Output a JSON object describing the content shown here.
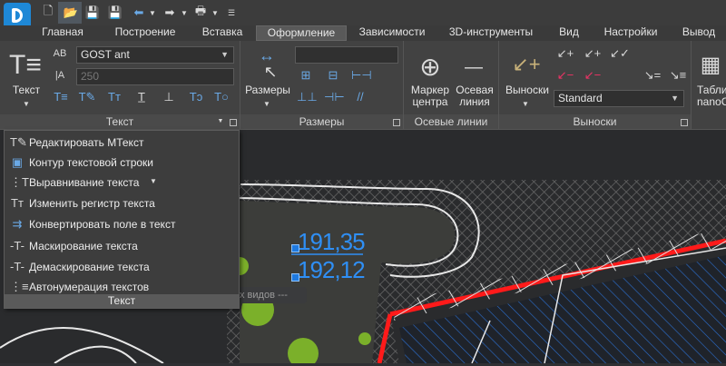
{
  "quick_access": {
    "icons": [
      "app-logo",
      "new-file-icon",
      "open-folder-icon",
      "save-icon",
      "save-all-icon",
      "undo-icon",
      "redo-icon",
      "print-icon",
      "customize-icon"
    ]
  },
  "tabs": [
    "Главная",
    "Построение",
    "Вставка",
    "Оформление",
    "Зависимости",
    "3D-инструменты",
    "Вид",
    "Настройки",
    "Вывод"
  ],
  "active_tab": "Оформление",
  "ribbon": {
    "text_panel": {
      "title": "Текст",
      "text_button": "Текст",
      "font": "GOST ant",
      "height_value": "250"
    },
    "dim_panel": {
      "title": "Размеры",
      "button": "Размеры"
    },
    "axis_panel": {
      "title": "Осевые линии",
      "marker": [
        "Маркер",
        "центра"
      ],
      "axis": [
        "Осевая",
        "линия"
      ]
    },
    "leaders_panel": {
      "title": "Выноски",
      "button": "Выноски",
      "style": "Standard"
    },
    "table_panel": {
      "label1": "Табли",
      "label2": "nanoC"
    }
  },
  "canvas": {
    "view_label": "х видов ---",
    "dim_top": "191,35",
    "dim_bottom": "192,12",
    "colors": {
      "dimension": "#2f8ff5",
      "red_line": "#ff1a1a",
      "hatch": "#2b6fd1",
      "tree": "#7bb02a",
      "ground": "#3c3d3a"
    }
  },
  "menu": {
    "items": [
      {
        "label": "Редактировать МТекст",
        "icon": "edit-mtext-icon"
      },
      {
        "label": "Контур текстовой строки",
        "icon": "text-frame-icon"
      },
      {
        "label": "Выравнивание текста",
        "icon": "text-align-icon"
      },
      {
        "label": "Изменить регистр текста",
        "icon": "text-case-icon"
      },
      {
        "label": "Конвертировать поле в текст",
        "icon": "field-to-text-icon"
      },
      {
        "label": "Маскирование текста",
        "icon": "text-mask-icon"
      },
      {
        "label": "Демаскирование текста",
        "icon": "text-unmask-icon"
      },
      {
        "label": "Автонумерация текстов",
        "icon": "text-autonumber-icon"
      }
    ],
    "footer": "Текст"
  }
}
